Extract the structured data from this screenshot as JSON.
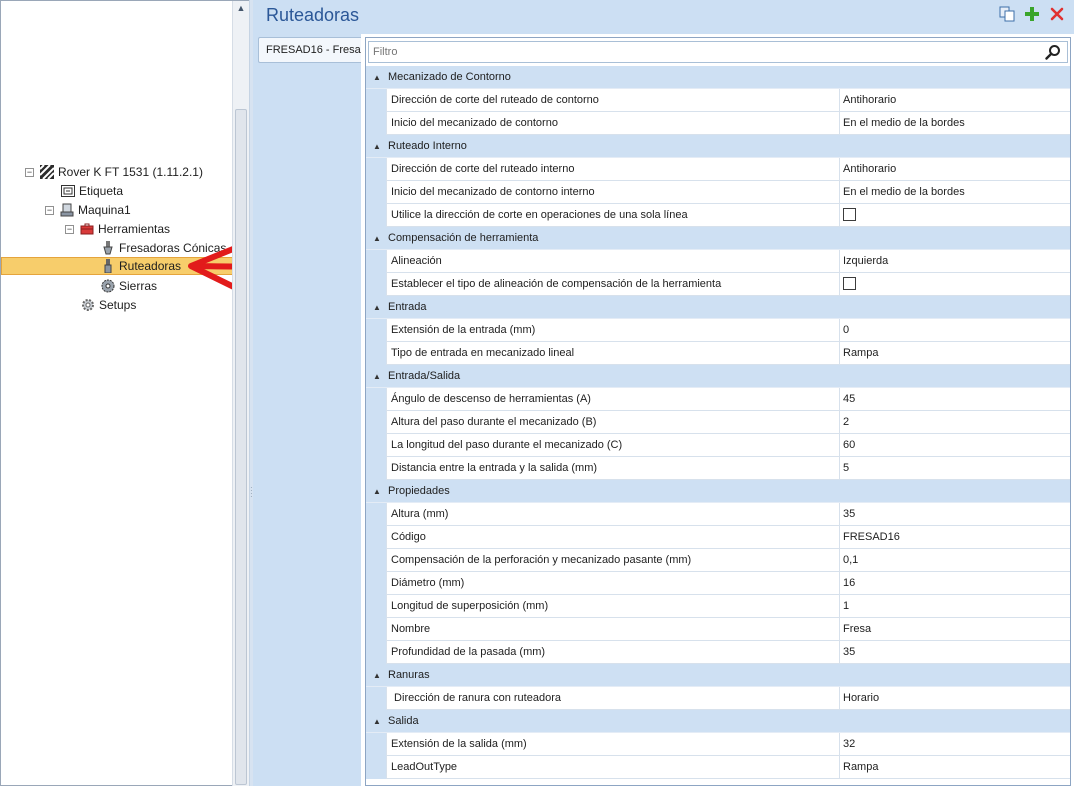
{
  "tree": {
    "root": "Rover K FT 1531 (1.11.2.1)",
    "etiqueta": "Etiqueta",
    "maquina": "Maquina1",
    "herramientas": "Herramientas",
    "fresadoras": "Fresadoras Cónicas",
    "ruteadoras": "Ruteadoras",
    "sierras": "Sierras",
    "setups": "Setups",
    "selected": "Ruteadoras"
  },
  "header": {
    "title": "Ruteadoras"
  },
  "tabs": [
    {
      "label": "FRESAD16 - Fresa"
    }
  ],
  "filter": {
    "placeholder": "Filtro"
  },
  "colors": {
    "header_bg": "#ccdff3",
    "title": "#2b5797",
    "selected_bg": "#f7cd6b",
    "add": "#3aa52a",
    "delete": "#e03030",
    "arrow": "#e21b1b"
  },
  "groups": [
    {
      "name": "Mecanizado de Contorno",
      "props": [
        {
          "name": "Dirección de corte del ruteado de contorno",
          "value": "Antihorario"
        },
        {
          "name": "Inicio del mecanizado de contorno",
          "value": "En el medio de la bordes"
        }
      ]
    },
    {
      "name": "Ruteado Interno",
      "props": [
        {
          "name": "Dirección de corte del ruteado interno",
          "value": "Antihorario"
        },
        {
          "name": "Inicio del mecanizado de contorno interno",
          "value": "En el medio de la bordes"
        },
        {
          "name": "Utilice la dirección de corte en operaciones de una sola línea",
          "value": "",
          "checkbox": true
        }
      ]
    },
    {
      "name": "Compensación de herramienta",
      "props": [
        {
          "name": "Alineación",
          "value": "Izquierda"
        },
        {
          "name": "Establecer el tipo de alineación de compensación de la herramienta",
          "value": "",
          "checkbox": true
        }
      ]
    },
    {
      "name": "Entrada",
      "props": [
        {
          "name": "Extensión de la entrada (mm)",
          "value": "0"
        },
        {
          "name": "Tipo de entrada en mecanizado lineal",
          "value": "Rampa"
        }
      ]
    },
    {
      "name": "Entrada/Salida",
      "props": [
        {
          "name": "Ángulo de descenso de herramientas (A)",
          "value": "45"
        },
        {
          "name": "Altura del paso durante el mecanizado (B)",
          "value": "2"
        },
        {
          "name": "La longitud del paso durante el mecanizado (C)",
          "value": "60"
        },
        {
          "name": "Distancia entre la entrada y la salida (mm)",
          "value": "5"
        }
      ]
    },
    {
      "name": "Propiedades",
      "props": [
        {
          "name": "Altura (mm)",
          "value": "35"
        },
        {
          "name": "Código",
          "value": "FRESAD16"
        },
        {
          "name": "Compensación de la perforación y mecanizado pasante (mm)",
          "value": "0,1"
        },
        {
          "name": "Diámetro (mm)",
          "value": "16"
        },
        {
          "name": "Longitud de superposición (mm)",
          "value": "1"
        },
        {
          "name": "Nombre",
          "value": "Fresa"
        },
        {
          "name": "Profundidad de la pasada (mm)",
          "value": "35"
        }
      ]
    },
    {
      "name": "Ranuras",
      "props": [
        {
          "name": " Dirección de ranura con ruteadora",
          "value": "Horario"
        }
      ]
    },
    {
      "name": "Salida",
      "props": [
        {
          "name": "Extensión de la salida (mm)",
          "value": "32"
        },
        {
          "name": "LeadOutType",
          "value": "Rampa"
        }
      ]
    }
  ]
}
